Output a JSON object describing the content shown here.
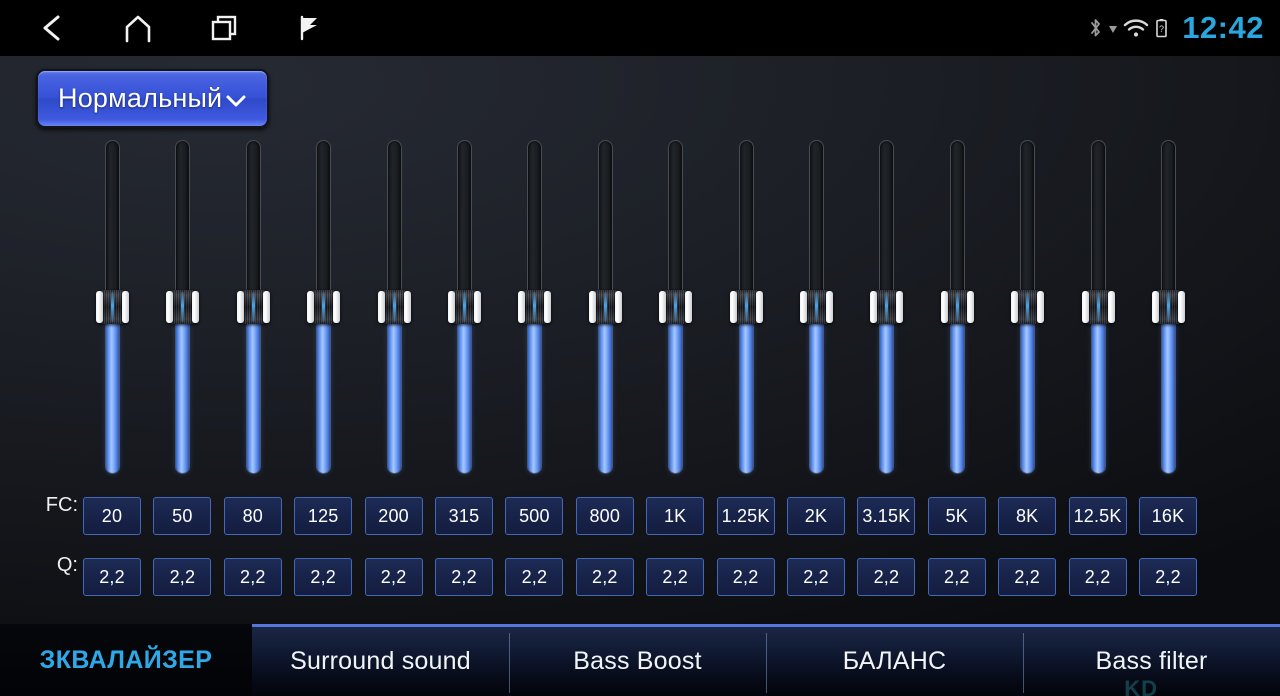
{
  "statusbar": {
    "nav": [
      {
        "name": "back-icon",
        "label": "Back"
      },
      {
        "name": "home-icon",
        "label": "Home"
      },
      {
        "name": "recents-icon",
        "label": "Recent apps"
      },
      {
        "name": "flag-icon",
        "label": "Flag"
      }
    ],
    "icons": [
      {
        "name": "bluetooth-icon",
        "label": "Bluetooth"
      },
      {
        "name": "signal-icon",
        "label": "Signal"
      },
      {
        "name": "wifi-icon",
        "label": "Wi-Fi"
      },
      {
        "name": "battery-unknown-icon",
        "label": "Battery unknown"
      }
    ],
    "clock": "12:42",
    "clock_color": "#29a8e0"
  },
  "preset": {
    "label": "Нормальный",
    "caret": "chevron-down-icon",
    "accent": "#3551d6"
  },
  "equalizer": {
    "fc_label": "FC:",
    "q_label": "Q:",
    "bands": [
      {
        "fc": "20",
        "q": "2,2",
        "value": 50
      },
      {
        "fc": "50",
        "q": "2,2",
        "value": 50
      },
      {
        "fc": "80",
        "q": "2,2",
        "value": 50
      },
      {
        "fc": "125",
        "q": "2,2",
        "value": 50
      },
      {
        "fc": "200",
        "q": "2,2",
        "value": 50
      },
      {
        "fc": "315",
        "q": "2,2",
        "value": 50
      },
      {
        "fc": "500",
        "q": "2,2",
        "value": 50
      },
      {
        "fc": "800",
        "q": "2,2",
        "value": 50
      },
      {
        "fc": "1K",
        "q": "2,2",
        "value": 50
      },
      {
        "fc": "1.25K",
        "q": "2,2",
        "value": 50
      },
      {
        "fc": "2K",
        "q": "2,2",
        "value": 50
      },
      {
        "fc": "3.15K",
        "q": "2,2",
        "value": 50
      },
      {
        "fc": "5K",
        "q": "2,2",
        "value": 50
      },
      {
        "fc": "8K",
        "q": "2,2",
        "value": 50
      },
      {
        "fc": "12.5K",
        "q": "2,2",
        "value": 50
      },
      {
        "fc": "16K",
        "q": "2,2",
        "value": 50
      }
    ],
    "fill_color": "#7ba8f5",
    "box_border_color": "#4368b8"
  },
  "tabs": [
    {
      "label": "ЗКВАЛАЙЗЕР",
      "active": true
    },
    {
      "label": "Surround sound",
      "active": false
    },
    {
      "label": "Bass Boost",
      "active": false
    },
    {
      "label": "БАЛАНС",
      "active": false
    },
    {
      "label": "Bass filter",
      "active": false
    }
  ],
  "watermark": "KD"
}
